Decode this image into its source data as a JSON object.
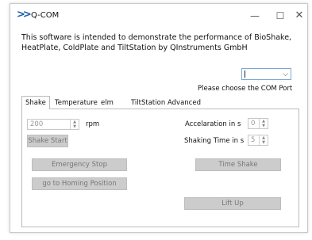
{
  "window": {
    "title": "Q-COM",
    "icon": "double-chevron-icon",
    "minimize": "—",
    "maximize": "☐",
    "close": "✕"
  },
  "description": "This software is intended to demonstrate the performance of BioShake, HeatPlate, ColdPlate and TiltStation by QInstruments GmbH",
  "com_port": {
    "value": "",
    "label": "Please choose the COM Port"
  },
  "tabs": [
    {
      "label": "Shake",
      "active": true
    },
    {
      "label": "Temperature"
    },
    {
      "label": "elm"
    },
    {
      "label": "TiltStation"
    },
    {
      "label": "Advanced"
    }
  ],
  "shake": {
    "speed_value": "200",
    "speed_unit": "rpm",
    "shake_start": "Shake Start",
    "acceleration_label": "Accelaration in s",
    "acceleration_value": "0",
    "shaking_time_label": "Shaking Time in s",
    "shaking_time_value": "5",
    "emergency_stop": "Emergency Stop",
    "homing": "go to Homing Position",
    "time_shake": "Time Shake",
    "lift_up": "Lift Up"
  }
}
